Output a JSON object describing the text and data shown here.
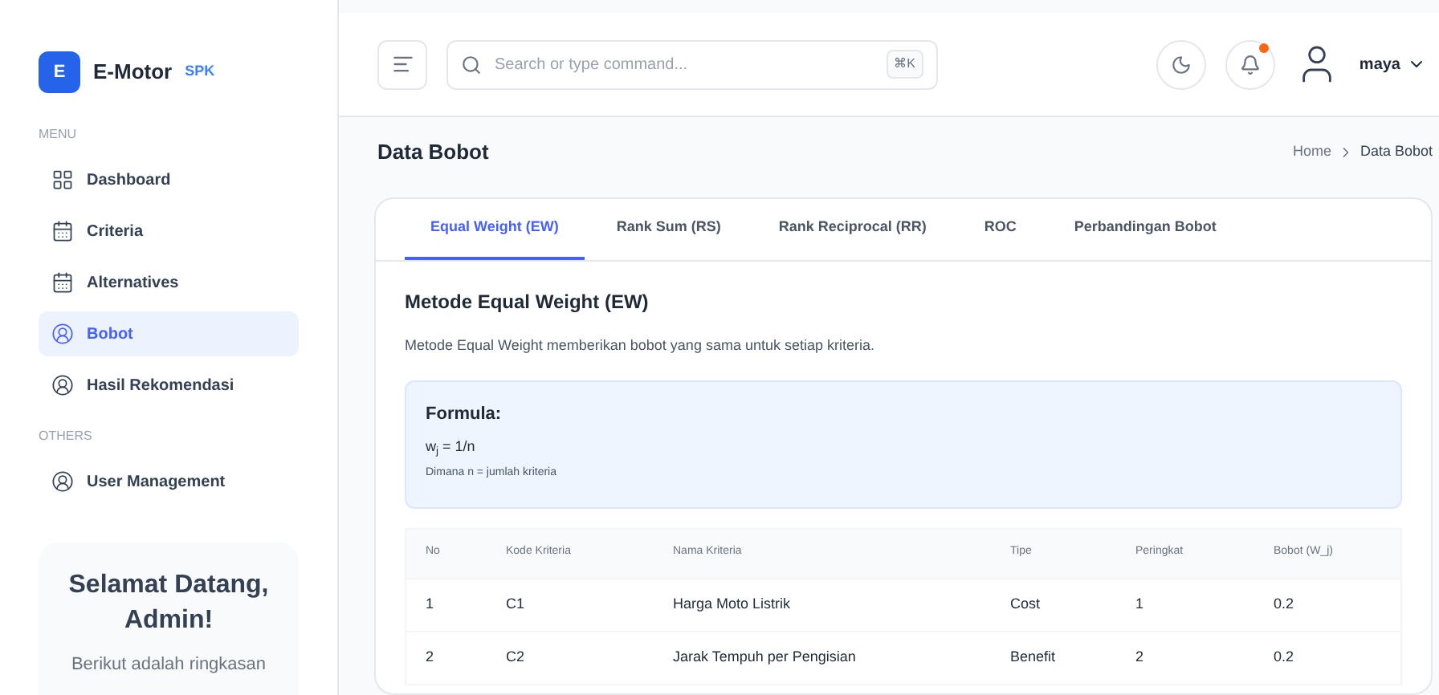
{
  "brand": {
    "logo_letter": "E",
    "name": "E-Motor",
    "badge": "SPK"
  },
  "sidebar": {
    "sections": [
      {
        "title": "MENU",
        "items": [
          {
            "label": "Dashboard",
            "kind": "grid",
            "selected": false
          },
          {
            "label": "Criteria",
            "kind": "calendar",
            "selected": false
          },
          {
            "label": "Alternatives",
            "kind": "calendar",
            "selected": false
          },
          {
            "label": "Bobot",
            "kind": "user",
            "selected": true
          },
          {
            "label": "Hasil Rekomendasi",
            "kind": "user",
            "selected": false
          }
        ]
      },
      {
        "title": "OTHERS",
        "items": [
          {
            "label": "User Management",
            "kind": "user",
            "selected": false
          }
        ]
      }
    ],
    "welcome": {
      "title": "Selamat Datang, Admin!",
      "text": "Berikut adalah ringkasan"
    }
  },
  "header": {
    "search": {
      "placeholder": "Search or type command...",
      "shortcut": "⌘K"
    },
    "notification_dot": true,
    "user": "maya"
  },
  "page": {
    "title": "Data Bobot",
    "breadcrumb": [
      "Home",
      "Data Bobot"
    ]
  },
  "tabs": [
    {
      "label": "Equal Weight (EW)",
      "selected": true
    },
    {
      "label": "Rank Sum (RS)",
      "selected": false
    },
    {
      "label": "Rank Reciprocal (RR)",
      "selected": false
    },
    {
      "label": "ROC",
      "selected": false
    },
    {
      "label": "Perbandingan Bobot",
      "selected": false
    }
  ],
  "method": {
    "title": "Metode Equal Weight (EW)",
    "description": "Metode Equal Weight memberikan bobot yang sama untuk setiap kriteria.",
    "formula_title": "Formula:",
    "formula": "w$_{j}$ = 1/n",
    "formula_note": "Dimana n = jumlah kriteria"
  },
  "table": {
    "columns": [
      "No",
      "Kode Kriteria",
      "Nama Kriteria",
      "Tipe",
      "Peringkat",
      "Bobot (W_j)"
    ],
    "rows": [
      [
        "1",
        "C1",
        "Harga Moto Listrik",
        "Cost",
        "1",
        "0.2"
      ],
      [
        "2",
        "C2",
        "Jarak Tempuh per Pengisian",
        "Benefit",
        "2",
        "0.2"
      ]
    ]
  }
}
